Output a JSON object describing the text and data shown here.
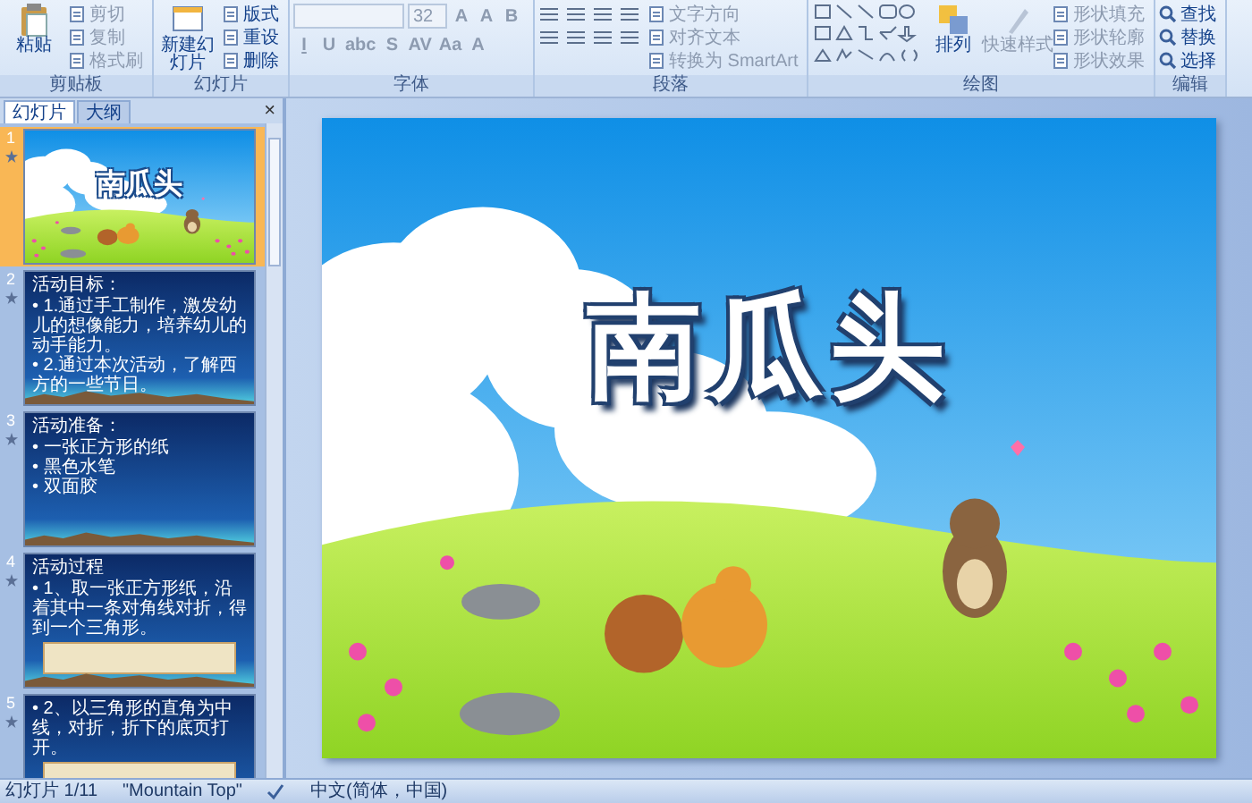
{
  "ribbon": {
    "groups": [
      {
        "kind": "clipboard",
        "label": "剪贴板",
        "commands": [
          {
            "kind": "large",
            "label": "粘贴",
            "disabled": false
          },
          {
            "kind": "small",
            "label": "剪切",
            "disabled": true
          },
          {
            "kind": "small",
            "label": "复制",
            "disabled": true
          },
          {
            "kind": "small",
            "label": "格式刷",
            "disabled": true
          }
        ]
      },
      {
        "kind": "slides",
        "label": "幻灯片",
        "commands": [
          {
            "kind": "large",
            "label": "新建幻灯片",
            "disabled": false
          },
          {
            "kind": "small",
            "label": "版式",
            "disabled": false
          },
          {
            "kind": "small",
            "label": "重设",
            "disabled": false
          },
          {
            "kind": "small",
            "label": "删除",
            "disabled": false
          }
        ]
      },
      {
        "kind": "font",
        "label": "字体",
        "commands": [
          {
            "kind": "field",
            "value": "32",
            "disabled": true
          },
          {
            "kind": "glyph",
            "label": "A",
            "disabled": true
          },
          {
            "kind": "glyph",
            "label": "A",
            "disabled": true
          },
          {
            "kind": "glyph",
            "label": "B",
            "disabled": true
          },
          {
            "kind": "glyph",
            "label": "I",
            "disabled": true
          },
          {
            "kind": "glyph",
            "label": "U",
            "disabled": true
          },
          {
            "kind": "glyph",
            "label": "abc",
            "disabled": true
          },
          {
            "kind": "glyph",
            "label": "S",
            "disabled": true
          },
          {
            "kind": "glyph",
            "label": "AV",
            "disabled": true
          },
          {
            "kind": "glyph",
            "label": "Aa",
            "disabled": true
          },
          {
            "kind": "glyph",
            "label": "A",
            "disabled": true
          }
        ]
      },
      {
        "kind": "paragraph",
        "label": "段落",
        "commands": [
          {
            "kind": "small",
            "label": "文字方向",
            "disabled": true
          },
          {
            "kind": "small",
            "label": "对齐文本",
            "disabled": true
          },
          {
            "kind": "small",
            "label": "转换为 SmartArt",
            "disabled": true
          }
        ]
      },
      {
        "kind": "drawing",
        "label": "绘图",
        "commands": [
          {
            "kind": "large",
            "label": "排列",
            "disabled": false
          },
          {
            "kind": "large",
            "label": "快速样式",
            "disabled": true
          },
          {
            "kind": "small",
            "label": "形状填充",
            "disabled": true
          },
          {
            "kind": "small",
            "label": "形状轮廓",
            "disabled": true
          },
          {
            "kind": "small",
            "label": "形状效果",
            "disabled": true
          }
        ]
      },
      {
        "kind": "editing",
        "label": "编辑",
        "commands": [
          {
            "kind": "small",
            "label": "查找",
            "disabled": false
          },
          {
            "kind": "small",
            "label": "替换",
            "disabled": false
          },
          {
            "kind": "small",
            "label": "选择",
            "disabled": false
          }
        ]
      }
    ]
  },
  "pane": {
    "tabs": [
      {
        "label": "幻灯片",
        "selected": true
      },
      {
        "label": "大纲",
        "selected": false
      }
    ],
    "close": "×",
    "slides": [
      {
        "number": "1",
        "kind": "title",
        "selected": true,
        "title": "南瓜头"
      },
      {
        "number": "2",
        "kind": "bullets",
        "selected": false,
        "title": "活动目标：",
        "bullets": [
          "• 1.通过手工制作，激发幼儿的想像能力，培养幼儿的动手能力。",
          "• 2.通过本次活动，了解西方的一些节日。"
        ]
      },
      {
        "number": "3",
        "kind": "bullets",
        "selected": false,
        "title": "活动准备：",
        "bullets": [
          "• 一张正方形的纸",
          "• 黑色水笔",
          "• 双面胶"
        ]
      },
      {
        "number": "4",
        "kind": "bullets-photo",
        "selected": false,
        "title": "活动过程",
        "bullets": [
          "• 1、取一张正方形纸，沿着其中一条对角线对折，得到一个三角形。"
        ]
      },
      {
        "number": "5",
        "kind": "bullets-photo",
        "selected": false,
        "bullets": [
          "• 2、以三角形的直角为中线，对折，折下的底页打开。"
        ]
      }
    ]
  },
  "main_slide": {
    "title": "南瓜头"
  },
  "status_bar": {
    "slide_indicator": "幻灯片 1/11",
    "theme": "\"Mountain Top\"",
    "language": "中文(简体，中国)"
  }
}
